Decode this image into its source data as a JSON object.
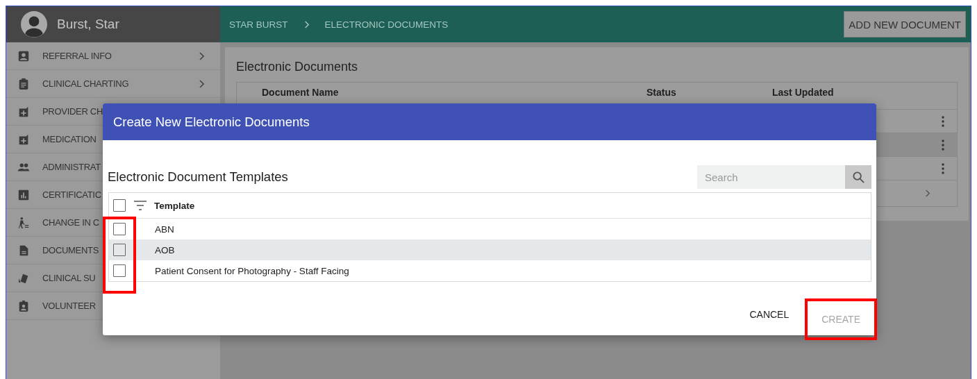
{
  "user": {
    "name": "Burst, Star"
  },
  "sidebar": {
    "items": [
      {
        "label": "REFERRAL INFO",
        "expandable": true
      },
      {
        "label": "CLINICAL CHARTING",
        "expandable": true
      },
      {
        "label": "PROVIDER CH",
        "expandable": false
      },
      {
        "label": "MEDICATION",
        "expandable": false
      },
      {
        "label": "ADMINISTRAT",
        "expandable": false
      },
      {
        "label": "CERTIFICATIC",
        "expandable": false
      },
      {
        "label": "CHANGE IN C",
        "expandable": false
      },
      {
        "label": "DOCUMENTS",
        "expandable": false
      },
      {
        "label": "CLINICAL SU",
        "expandable": false
      },
      {
        "label": "VOLUNTEER",
        "expandable": false
      }
    ]
  },
  "breadcrumb": [
    "STAR BURST",
    "ELECTRONIC DOCUMENTS"
  ],
  "add_button": "ADD NEW DOCUMENT",
  "documents": {
    "title": "Electronic Documents",
    "columns": [
      "Document Name",
      "Status",
      "Last Updated"
    ],
    "rows": [
      {
        "selected": false
      },
      {
        "selected": true
      },
      {
        "selected": false
      }
    ]
  },
  "dialog": {
    "title": "Create New Electronic Documents",
    "section_title": "Electronic Document Templates",
    "search": {
      "placeholder": "Search"
    },
    "select_all": {
      "checked": false
    },
    "column": "Template",
    "templates": [
      {
        "name": "ABN",
        "checked": false,
        "selected": false
      },
      {
        "name": "AOB",
        "checked": false,
        "selected": true
      },
      {
        "name": "Patient Consent for Photography - Staff Facing",
        "checked": false,
        "selected": false
      }
    ],
    "cancel": "CANCEL",
    "create": {
      "label": "CREATE",
      "disabled": true
    },
    "highlights": {
      "row_checkboxes": true,
      "create_button": true
    }
  }
}
